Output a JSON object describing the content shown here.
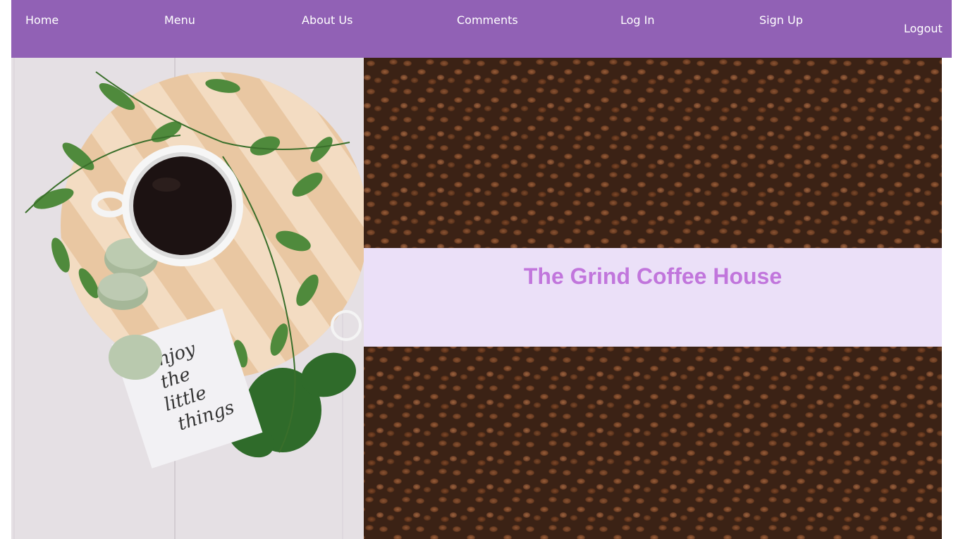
{
  "nav": {
    "home": "Home",
    "menu": "Menu",
    "about": "About Us",
    "comments": "Comments",
    "login": "Log In",
    "signup": "Sign Up",
    "logout": "Logout"
  },
  "hero": {
    "title": "The Grind Coffee House",
    "note_text": [
      "enjoy",
      "the",
      "little",
      "things"
    ]
  },
  "colors": {
    "nav_bg": "#9161b5",
    "title_band_bg": "#ebe0f8",
    "title_text": "#c176dc",
    "nav_text": "#ffffff"
  }
}
